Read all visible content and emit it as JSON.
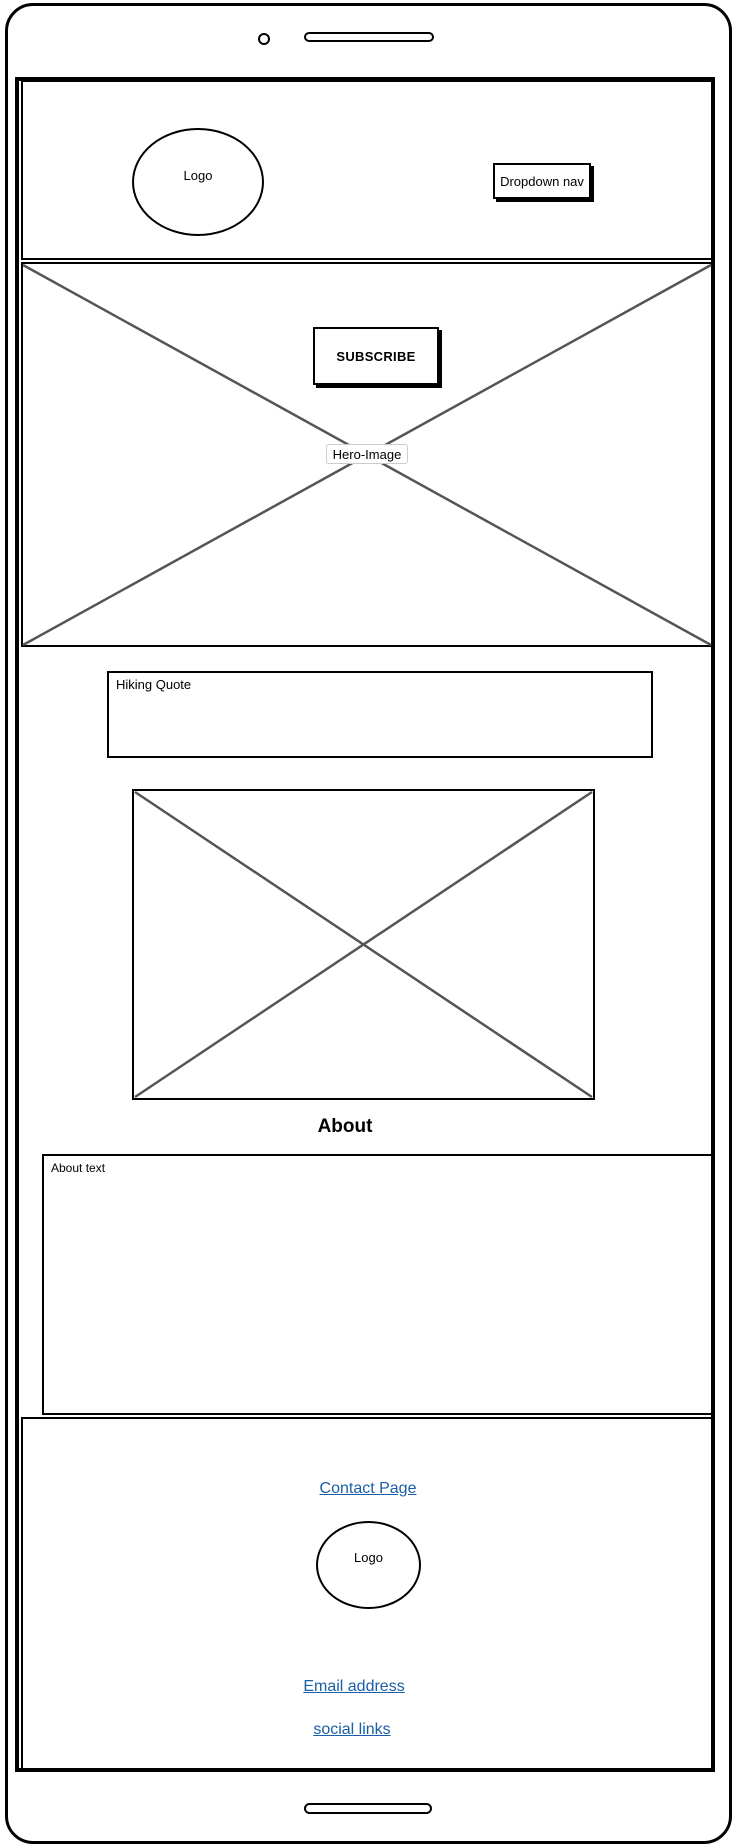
{
  "header": {
    "logo_label": "Logo",
    "dropdown_label": "Dropdown nav"
  },
  "hero": {
    "subscribe_label": "SUBSCRIBE",
    "image_label": "Hero-Image"
  },
  "quote": {
    "label": "Hiking Quote"
  },
  "about": {
    "heading": "About",
    "text_label": "About text"
  },
  "footer": {
    "contact_link": "Contact Page",
    "logo_label": "Logo",
    "email_link": "Email address",
    "social_link": "social links"
  },
  "colors": {
    "link": "#1a5ea6",
    "placeholder_lines": "#555555"
  }
}
